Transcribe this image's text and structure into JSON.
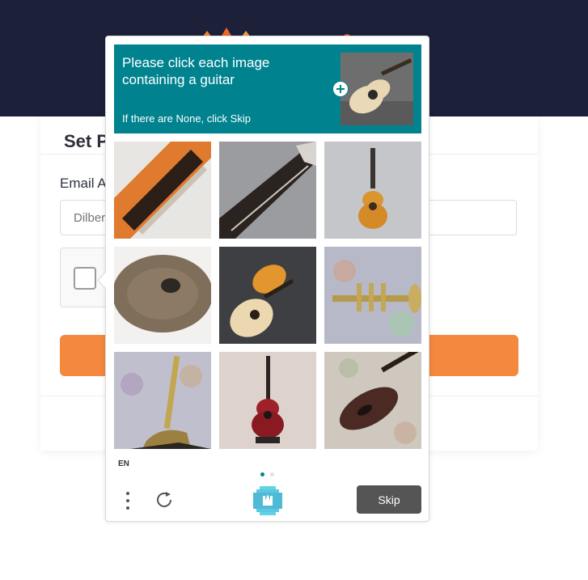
{
  "page": {
    "title_visible": "Set P",
    "email_label_visible": "Email A",
    "email_placeholder_visible": "Dilbert"
  },
  "challenge": {
    "prompt": "Please click each image containing a guitar",
    "subtext": "If there are None, click Skip",
    "language": "EN",
    "skip_label": "Skip",
    "tiles": [
      {
        "subject": "guitar neck closeup"
      },
      {
        "subject": "guitar fretboard"
      },
      {
        "subject": "acoustic guitar"
      },
      {
        "subject": "cymbal"
      },
      {
        "subject": "acoustic guitar"
      },
      {
        "subject": "trumpet"
      },
      {
        "subject": "saxophone"
      },
      {
        "subject": "red electric acoustic guitar"
      },
      {
        "subject": "violin"
      }
    ],
    "pager": {
      "pages": 2,
      "active": 1
    }
  },
  "colors": {
    "header_bg": "#1c2039",
    "prompt_bg": "#00838f",
    "submit_bg": "#f4883e",
    "skip_bg": "#555555"
  },
  "icons": [
    "menu-icon",
    "refresh-icon",
    "hcaptcha-logo-icon",
    "zoom-in-icon"
  ]
}
